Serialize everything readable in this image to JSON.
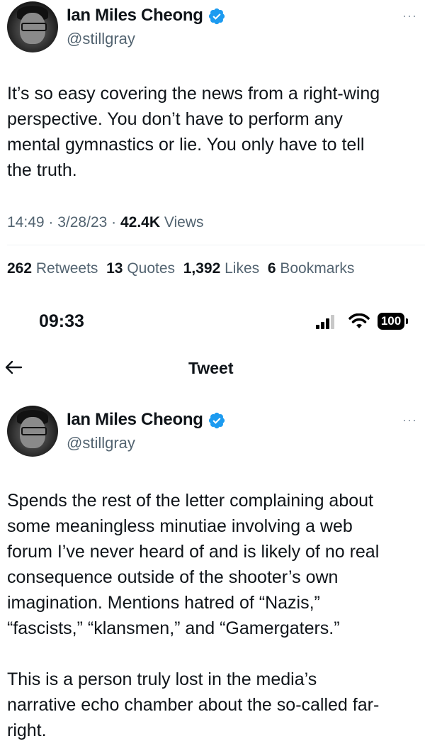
{
  "tweet1": {
    "author": {
      "name": "Ian Miles Cheong",
      "handle": "@stillgray"
    },
    "more": "···",
    "text_lines": [
      "It’s so easy covering the news from a right-wing",
      "perspective. You don’t have to perform any",
      "mental gymnastics or lie. You only have to tell",
      "the truth."
    ],
    "time": "14:49",
    "date": "3/28/23",
    "views_count": "42.4K",
    "views_label": "Views",
    "stats": {
      "retweets_count": "262",
      "retweets_label": "Retweets",
      "quotes_count": "13",
      "quotes_label": "Quotes",
      "likes_count": "1,392",
      "likes_label": "Likes",
      "bookmarks_count": "6",
      "bookmarks_label": "Bookmarks"
    }
  },
  "status_bar": {
    "time": "09:33",
    "battery": "100"
  },
  "nav": {
    "title": "Tweet"
  },
  "tweet2": {
    "author": {
      "name": "Ian Miles Cheong",
      "handle": "@stillgray"
    },
    "more": "···",
    "text_lines": [
      "Spends the rest of the letter complaining about",
      "some meaningless minutiae involving a web",
      "forum I’ve never heard of and is likely of no real",
      "consequence outside of the shooter’s own",
      "imagination. Mentions hatred of “Nazis,”",
      "“fascists,” “klansmen,” and “Gamergaters.”",
      "",
      "This is a person truly lost in the media’s",
      "narrative echo chamber about the so-called far-",
      "right."
    ]
  }
}
